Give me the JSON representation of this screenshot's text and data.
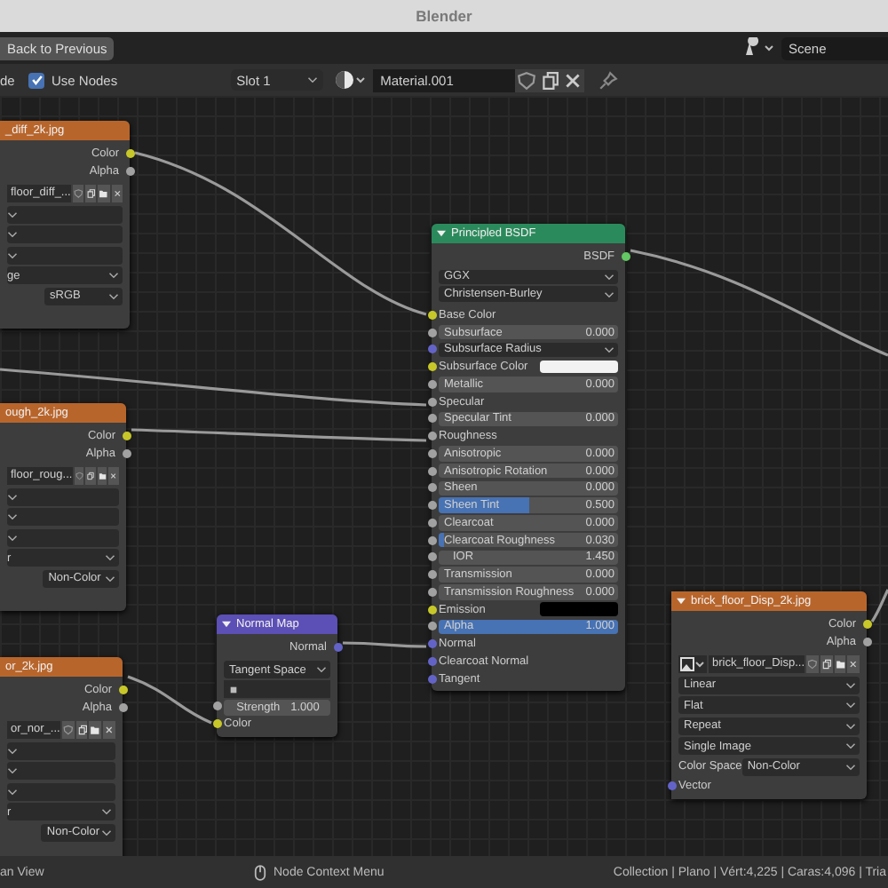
{
  "window": {
    "title": "Blender"
  },
  "header": {
    "back_button": "Back to Previous",
    "scene": "Scene",
    "mode_label": "de",
    "use_nodes": {
      "label": "Use Nodes",
      "checked": true
    },
    "slot": "Slot 1",
    "material": "Material.001"
  },
  "image_nodes": [
    {
      "title": "_diff_2k.jpg",
      "outputs": [
        {
          "label": "Color",
          "color": "#c7c729"
        },
        {
          "label": "Alpha",
          "color": "#a1a1a1"
        }
      ],
      "image_name": "floor_diff_...",
      "options": [
        "ge"
      ],
      "color_space": "sRGB"
    },
    {
      "title": "ough_2k.jpg",
      "outputs": [
        {
          "label": "Color",
          "color": "#c7c729"
        },
        {
          "label": "Alpha",
          "color": "#a1a1a1"
        }
      ],
      "image_name": "floor_roug...",
      "options": [
        "r"
      ],
      "color_space": "Non-Color"
    },
    {
      "title": "or_2k.jpg",
      "outputs": [
        {
          "label": "Color",
          "color": "#c7c729"
        },
        {
          "label": "Alpha",
          "color": "#a1a1a1"
        }
      ],
      "image_name": "or_nor_...",
      "options": [
        "r"
      ],
      "color_space": "Non-Color"
    },
    {
      "title": "brick_floor_Disp_2k.jpg",
      "outputs": [
        {
          "label": "Color",
          "color": "#c7c729"
        },
        {
          "label": "Alpha",
          "color": "#a1a1a1"
        }
      ],
      "image_name": "brick_floor_Disp...",
      "options": [
        "Linear",
        "Flat",
        "Repeat",
        "Single Image"
      ],
      "color_space_label": "Color Space",
      "color_space": "Non-Color",
      "inputs": [
        {
          "label": "Vector",
          "color": "#6363c7"
        }
      ]
    }
  ],
  "normal_map": {
    "title": "Normal Map",
    "outputs": [
      {
        "label": "Normal",
        "color": "#6363c7"
      }
    ],
    "space": "Tangent Space",
    "strength_label": "Strength",
    "strength": "1.000",
    "inputs": [
      {
        "label": "Color",
        "color": "#c7c729"
      }
    ]
  },
  "bsdf": {
    "title": "Principled BSDF",
    "outputs": [
      {
        "label": "BSDF",
        "color": "#63c763"
      }
    ],
    "rows": [
      {
        "kind": "dropdown",
        "text": "GGX"
      },
      {
        "kind": "dropdown",
        "text": "Christensen-Burley"
      },
      {
        "kind": "socket",
        "label": "Base Color",
        "socket": {
          "color": "#c7c729"
        }
      },
      {
        "kind": "slider",
        "label": "Subsurface",
        "value": "0.000",
        "level": 0,
        "socket": {
          "color": "#a1a1a1"
        }
      },
      {
        "kind": "dropdown",
        "text": "Subsurface Radius",
        "socket": {
          "color": "#6363c7"
        }
      },
      {
        "kind": "swatch",
        "label": "Subsurface Color",
        "color": "#f2f2f2",
        "socket": {
          "color": "#c7c729"
        }
      },
      {
        "kind": "slider",
        "label": "Metallic",
        "value": "0.000",
        "level": 0,
        "socket": {
          "color": "#a1a1a1"
        }
      },
      {
        "kind": "socket",
        "label": "Specular",
        "socket": {
          "color": "#a1a1a1"
        }
      },
      {
        "kind": "slider",
        "label": "Specular Tint",
        "value": "0.000",
        "level": 0,
        "socket": {
          "color": "#a1a1a1"
        }
      },
      {
        "kind": "socket",
        "label": "Roughness",
        "socket": {
          "color": "#a1a1a1"
        }
      },
      {
        "kind": "slider",
        "label": "Anisotropic",
        "value": "0.000",
        "level": 0,
        "socket": {
          "color": "#a1a1a1"
        }
      },
      {
        "kind": "slider",
        "label": "Anisotropic Rotation",
        "value": "0.000",
        "level": 0,
        "socket": {
          "color": "#a1a1a1"
        }
      },
      {
        "kind": "slider",
        "label": "Sheen",
        "value": "0.000",
        "level": 0,
        "socket": {
          "color": "#a1a1a1"
        }
      },
      {
        "kind": "slider",
        "label": "Sheen Tint",
        "value": "0.500",
        "level": 0.5,
        "socket": {
          "color": "#a1a1a1"
        }
      },
      {
        "kind": "slider",
        "label": "Clearcoat",
        "value": "0.000",
        "level": 0,
        "socket": {
          "color": "#a1a1a1"
        }
      },
      {
        "kind": "slider",
        "label": "Clearcoat Roughness",
        "value": "0.030",
        "level": 0.03,
        "socket": {
          "color": "#a1a1a1"
        }
      },
      {
        "kind": "number",
        "label": "IOR",
        "value": "1.450",
        "socket": {
          "color": "#a1a1a1"
        }
      },
      {
        "kind": "slider",
        "label": "Transmission",
        "value": "0.000",
        "level": 0,
        "socket": {
          "color": "#a1a1a1"
        }
      },
      {
        "kind": "slider",
        "label": "Transmission Roughness",
        "value": "0.000",
        "level": 0,
        "socket": {
          "color": "#a1a1a1"
        }
      },
      {
        "kind": "swatch",
        "label": "Emission",
        "color": "#000000",
        "socket": {
          "color": "#c7c729"
        }
      },
      {
        "kind": "slider",
        "label": "Alpha",
        "value": "1.000",
        "level": 1,
        "socket": {
          "color": "#a1a1a1"
        }
      },
      {
        "kind": "socket",
        "label": "Normal",
        "socket": {
          "color": "#6363c7"
        }
      },
      {
        "kind": "socket",
        "label": "Clearcoat Normal",
        "socket": {
          "color": "#6363c7"
        }
      },
      {
        "kind": "socket",
        "label": "Tangent",
        "socket": {
          "color": "#6363c7"
        }
      }
    ]
  },
  "status_bar": {
    "left": "an View",
    "context": "Node Context Menu",
    "stats": "Collection | Plano | Vért:4,225 | Caras:4,096 | Tria"
  }
}
